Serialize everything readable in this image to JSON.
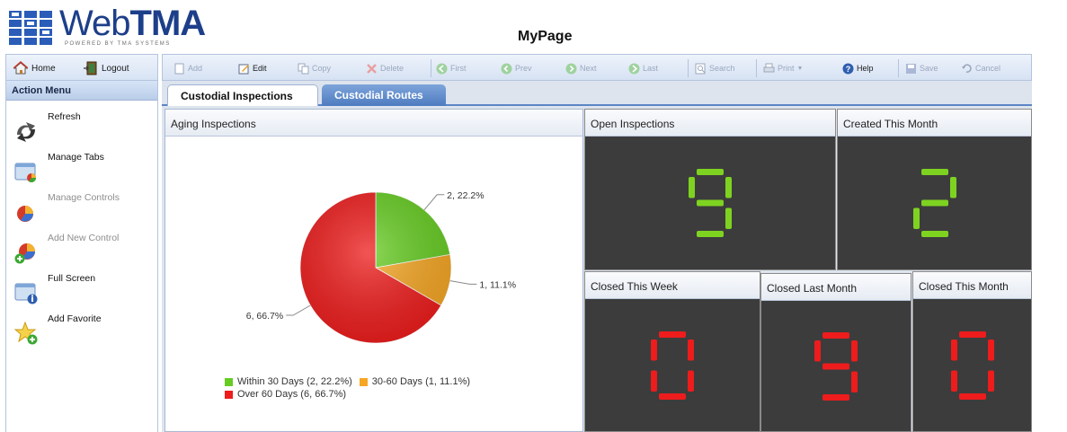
{
  "header": {
    "logo_text_light": "Web",
    "logo_text_bold": "TMA",
    "logo_tagline": "POWERED BY TMA SYSTEMS",
    "page_title": "MyPage"
  },
  "topnav": {
    "home_label": "Home",
    "logout_label": "Logout"
  },
  "toolbar": [
    {
      "label": "Add",
      "icon": "add-icon",
      "enabled": false
    },
    {
      "label": "Edit",
      "icon": "edit-icon",
      "enabled": true
    },
    {
      "label": "Copy",
      "icon": "copy-icon",
      "enabled": false
    },
    {
      "label": "Delete",
      "icon": "delete-icon",
      "enabled": false
    },
    {
      "label": "First",
      "icon": "first-icon",
      "enabled": false
    },
    {
      "label": "Prev",
      "icon": "prev-icon",
      "enabled": false
    },
    {
      "label": "Next",
      "icon": "next-icon",
      "enabled": false
    },
    {
      "label": "Last",
      "icon": "last-icon",
      "enabled": false
    },
    {
      "label": "Search",
      "icon": "search-icon",
      "enabled": false
    },
    {
      "label": "Print",
      "icon": "print-icon",
      "enabled": false
    },
    {
      "label": "Help",
      "icon": "help-icon",
      "enabled": true
    },
    {
      "label": "Save",
      "icon": "save-icon",
      "enabled": false
    },
    {
      "label": "Cancel",
      "icon": "cancel-icon",
      "enabled": false
    }
  ],
  "sidebar": {
    "title": "Action Menu",
    "items": [
      {
        "label": "Refresh",
        "icon": "refresh-icon",
        "enabled": true
      },
      {
        "label": "Manage Tabs",
        "icon": "manage-tabs-icon",
        "enabled": true
      },
      {
        "label": "Manage Controls",
        "icon": "manage-controls-icon",
        "enabled": false
      },
      {
        "label": "Add New Control",
        "icon": "add-control-icon",
        "enabled": false
      },
      {
        "label": "Full Screen",
        "icon": "full-screen-icon",
        "enabled": true
      },
      {
        "label": "Add Favorite",
        "icon": "add-favorite-icon",
        "enabled": true
      }
    ]
  },
  "tabs": [
    {
      "label": "Custodial Inspections",
      "active": true
    },
    {
      "label": "Custodial Routes",
      "active": false
    }
  ],
  "aging": {
    "title": "Aging Inspections",
    "chart_data": {
      "type": "pie",
      "title": "",
      "slices": [
        {
          "name": "Within 30 Days",
          "value": 2,
          "percent": 22.2,
          "color": "#66cc22",
          "label": "2, 22.2%",
          "legend": "Within 30 Days (2, 22.2%)"
        },
        {
          "name": "30-60 Days",
          "value": 1,
          "percent": 11.1,
          "color": "#f5a623",
          "label": "1, 11.1%",
          "legend": "30-60 Days (1, 11.1%)"
        },
        {
          "name": "Over 60 Days",
          "value": 6,
          "percent": 66.7,
          "color": "#ee1c1c",
          "label": "6, 66.7%",
          "legend": "Over 60 Days (6, 66.7%)"
        }
      ],
      "legend_position": "bottom"
    }
  },
  "kpis": {
    "open_inspections": {
      "title": "Open Inspections",
      "value": "9",
      "color": "#7ed321"
    },
    "created_this_month": {
      "title": "Created This Month",
      "value": "2",
      "color": "#7ed321"
    },
    "closed_this_week": {
      "title": "Closed This Week",
      "value": "0",
      "color": "#ee1c1c"
    },
    "closed_last_month": {
      "title": "Closed Last Month",
      "value": "9",
      "color": "#ee1c1c"
    },
    "closed_this_month": {
      "title": "Closed This Month",
      "value": "0",
      "color": "#ee1c1c"
    }
  }
}
